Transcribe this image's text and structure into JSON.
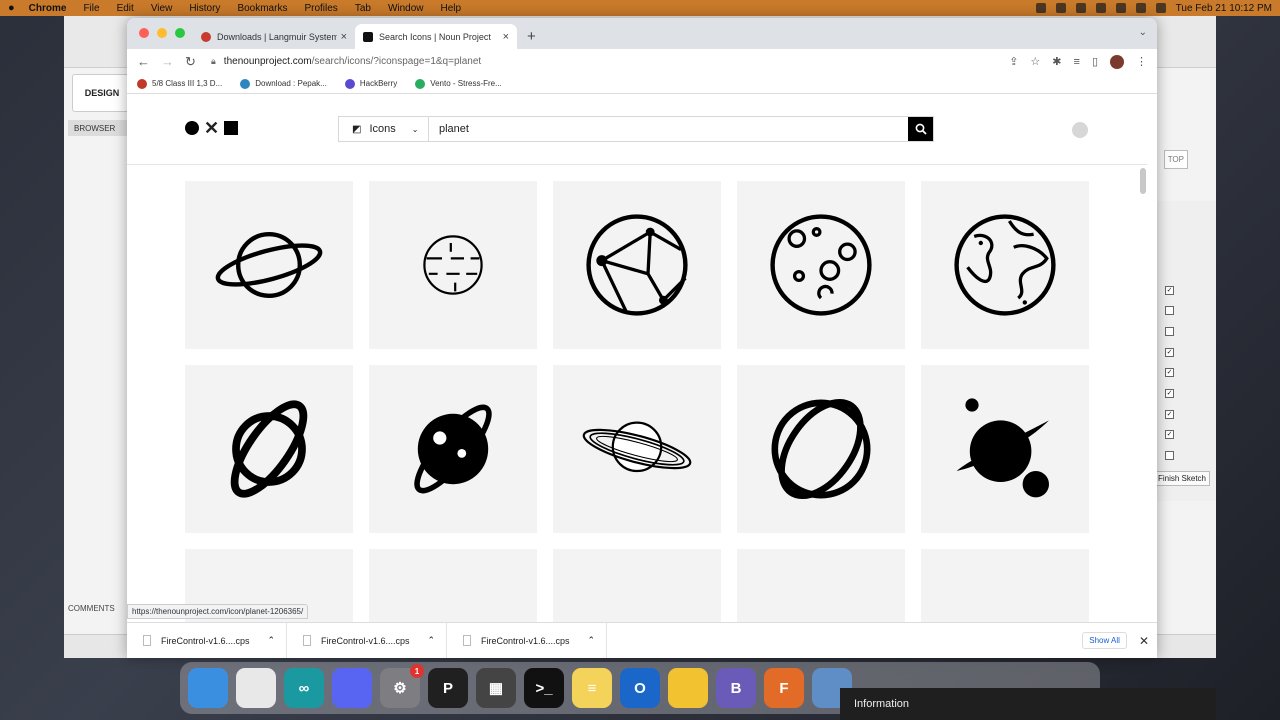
{
  "menubar": {
    "app": "Chrome",
    "items": [
      "File",
      "Edit",
      "View",
      "History",
      "Bookmarks",
      "Profiles",
      "Tab",
      "Window",
      "Help"
    ],
    "datetime": "Tue Feb 21  10:12 PM"
  },
  "bgapp": {
    "design_label": "DESIGN",
    "browser_label": "BROWSER",
    "comments_label": "COMMENTS",
    "top_label": "TOP",
    "finish_label": "Finish Sketch"
  },
  "tabs": [
    {
      "label": "Downloads | Langmuir Systems",
      "active": false,
      "favicon_color": "#c93b2e"
    },
    {
      "label": "Search Icons | Noun Project",
      "active": true,
      "favicon_color": "#111111"
    }
  ],
  "address": {
    "host": "thenounproject.com",
    "path": "/search/icons/?iconspage=1&q=planet"
  },
  "bookmarks": [
    {
      "label": "5/8 Class III 1,3 D...",
      "color": "#c0392b"
    },
    {
      "label": "Download : Pepak...",
      "color": "#2e86c1"
    },
    {
      "label": "HackBerry",
      "color": "#5b4ad1"
    },
    {
      "label": "Vento - Stress-Fre...",
      "color": "#27ae60"
    }
  ],
  "search": {
    "type_label": "Icons",
    "query": "planet"
  },
  "results": [
    {
      "icon": "planet-ring-outline-icon"
    },
    {
      "icon": "planet-dashed-outline-icon"
    },
    {
      "icon": "planet-network-outline-icon"
    },
    {
      "icon": "moon-craters-outline-icon"
    },
    {
      "icon": "earth-outline-icon"
    },
    {
      "icon": "planet-ring-bold-icon"
    },
    {
      "icon": "planet-ring-solid-face-icon"
    },
    {
      "icon": "saturn-sketch-icon"
    },
    {
      "icon": "planet-ring-thick-outline-icon"
    },
    {
      "icon": "planet-solid-moons-icon"
    },
    {
      "icon": "planet-ring-outline-partial-icon"
    },
    {
      "icon": "planet-ears-outline-partial-icon"
    },
    {
      "icon": "planet-solid-partial-icon"
    },
    {
      "icon": "planet-ears-solid-partial-icon"
    },
    {
      "icon": "planet-solid-partial-2-icon"
    }
  ],
  "status_url": "https://thenounproject.com/icon/planet-1206365/",
  "downloads": [
    {
      "name": "FireControl-v1.6....cps"
    },
    {
      "name": "FireControl-v1.6....cps"
    },
    {
      "name": "FireControl-v1.6....cps"
    }
  ],
  "show_all_label": "Show All",
  "dock": [
    {
      "name": "finder",
      "color": "#3b8fe0",
      "text": "",
      "badge": ""
    },
    {
      "name": "chrome",
      "color": "#e8e8e8",
      "text": "",
      "badge": ""
    },
    {
      "name": "arduino",
      "color": "#1a9aa0",
      "text": "∞",
      "badge": ""
    },
    {
      "name": "discord",
      "color": "#5865f2",
      "text": "",
      "badge": ""
    },
    {
      "name": "system-preferences",
      "color": "#7d7d82",
      "text": "⚙",
      "badge": "1"
    },
    {
      "name": "pixelmator",
      "color": "#202020",
      "text": "P",
      "badge": ""
    },
    {
      "name": "calculator",
      "color": "#444",
      "text": "▦",
      "badge": ""
    },
    {
      "name": "terminal",
      "color": "#111",
      "text": ">_",
      "badge": ""
    },
    {
      "name": "notes",
      "color": "#f3d35a",
      "text": "≡",
      "badge": ""
    },
    {
      "name": "outlook",
      "color": "#1b67c9",
      "text": "O",
      "badge": ""
    },
    {
      "name": "cyberduck",
      "color": "#f2c230",
      "text": "",
      "badge": ""
    },
    {
      "name": "bbedit",
      "color": "#6b5bb8",
      "text": "B",
      "badge": ""
    },
    {
      "name": "fusion-360",
      "color": "#e26c27",
      "text": "F",
      "badge": ""
    },
    {
      "name": "quicktime",
      "color": "#5f8dc5",
      "text": "",
      "badge": ""
    }
  ],
  "info_label": "Information"
}
